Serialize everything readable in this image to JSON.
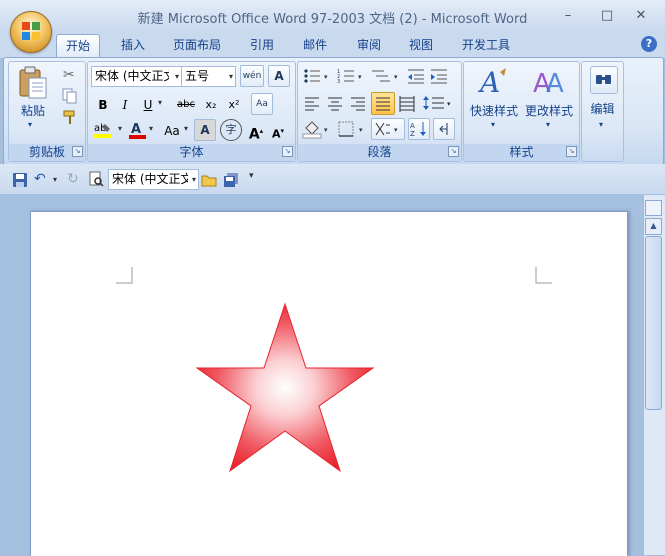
{
  "window": {
    "title": "新建 Microsoft Office Word 97-2003 文档 (2) - Microsoft Word",
    "controls": {
      "minimize": "–",
      "maximize": "□",
      "close": "✕"
    }
  },
  "tabs": [
    {
      "label": "开始",
      "active": true
    },
    {
      "label": "插入"
    },
    {
      "label": "页面布局"
    },
    {
      "label": "引用"
    },
    {
      "label": "邮件"
    },
    {
      "label": "审阅"
    },
    {
      "label": "视图"
    },
    {
      "label": "开发工具"
    }
  ],
  "help": "?",
  "ribbon": {
    "clipboard": {
      "label": "剪贴板",
      "paste": "粘贴"
    },
    "font": {
      "label": "字体",
      "font_name": "宋体 (中文正文)",
      "font_size": "五号",
      "bold": "B",
      "italic": "I",
      "underline": "U",
      "strike": "abc",
      "subscript": "x₂",
      "superscript": "x²",
      "change_case": "Aa",
      "grow": "A",
      "shrink": "A",
      "char_border": "A",
      "enclose": "字"
    },
    "paragraph": {
      "label": "段落"
    },
    "styles": {
      "label": "样式",
      "quick_styles": "快速样式",
      "change_styles": "更改样式"
    },
    "editing": {
      "label": "编辑"
    }
  },
  "qat": {
    "font_name": "宋体 (中文正文)"
  },
  "colors": {
    "accent": "#15428b",
    "star_edge": "#e8232e",
    "star_center": "#ffffff"
  }
}
